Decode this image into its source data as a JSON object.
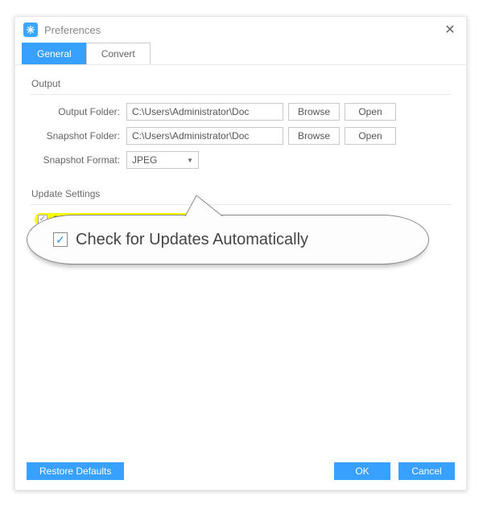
{
  "header": {
    "title": "Preferences"
  },
  "tabs": {
    "general": "General",
    "convert": "Convert"
  },
  "sections": {
    "output": {
      "title": "Output",
      "outputFolderLabel": "Output Folder:",
      "outputFolderValue": "C:\\Users\\Administrator\\Doc",
      "snapshotFolderLabel": "Snapshot Folder:",
      "snapshotFolderValue": "C:\\Users\\Administrator\\Doc",
      "snapshotFormatLabel": "Snapshot Format:",
      "snapshotFormatValue": "JPEG",
      "browseLabel": "Browse",
      "openLabel": "Open"
    },
    "update": {
      "title": "Update Settings",
      "checkboxLabel": "Check for Updates Automatically"
    }
  },
  "callout": {
    "label": "Check for Updates Automatically"
  },
  "footer": {
    "restore": "Restore Defaults",
    "ok": "OK",
    "cancel": "Cancel"
  }
}
